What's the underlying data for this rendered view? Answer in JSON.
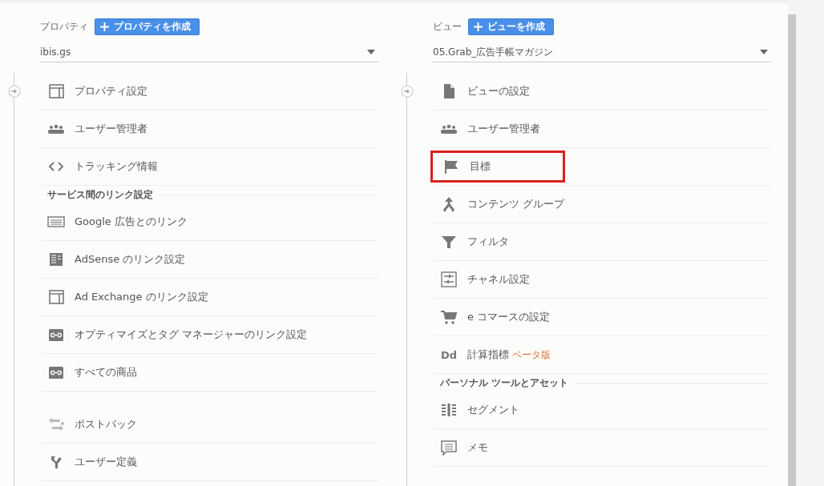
{
  "columns": [
    {
      "label": "プロパティ",
      "create_button": "プロパティを作成",
      "selector": {
        "value": "ibis.gs"
      },
      "groups": [
        {
          "items": [
            {
              "kind": "layout",
              "label": "プロパティ設定",
              "highlighted": false
            },
            {
              "kind": "people",
              "label": "ユーザー管理者",
              "highlighted": false
            },
            {
              "kind": "code",
              "label": "トラッキング情報",
              "highlighted": false
            }
          ]
        },
        {
          "header": "サービス間のリンク設定",
          "items": [
            {
              "kind": "ads",
              "label": "Google 広告とのリンク",
              "highlighted": false
            },
            {
              "kind": "adsense",
              "label": "AdSense のリンク設定",
              "highlighted": false
            },
            {
              "kind": "layout",
              "label": "Ad Exchange のリンク設定",
              "highlighted": false
            },
            {
              "kind": "link",
              "label": "オプティマイズとタグ マネージャーのリンク設定",
              "highlighted": false
            },
            {
              "kind": "link",
              "label": "すべての商品",
              "highlighted": false
            }
          ]
        },
        {
          "items": [
            {
              "kind": "postback",
              "label": "ポストバック",
              "highlighted": false
            },
            {
              "kind": "fork",
              "label": "ユーザー定義",
              "highlighted": false
            }
          ]
        }
      ]
    },
    {
      "label": "ビュー",
      "create_button": "ビューを作成",
      "selector": {
        "value": "05.Grab_広告手帳マガジン"
      },
      "groups": [
        {
          "items": [
            {
              "kind": "doc",
              "label": "ビューの設定",
              "highlighted": false
            },
            {
              "kind": "people",
              "label": "ユーザー管理者",
              "highlighted": false
            },
            {
              "kind": "flag",
              "label": "目標",
              "highlighted": true
            },
            {
              "kind": "merge",
              "label": "コンテンツ グループ",
              "highlighted": false
            },
            {
              "kind": "filter",
              "label": "フィルタ",
              "highlighted": false
            },
            {
              "kind": "channel",
              "label": "チャネル設定",
              "highlighted": false
            },
            {
              "kind": "cart",
              "label": "e コマースの設定",
              "highlighted": false
            },
            {
              "kind": "text",
              "icon_text": "Dd",
              "label": "計算指標",
              "badge": "ベータ版",
              "highlighted": false
            }
          ]
        },
        {
          "header": "パーソナル ツールとアセット",
          "items": [
            {
              "kind": "segment",
              "label": "セグメント",
              "highlighted": false
            },
            {
              "kind": "memo",
              "label": "メモ",
              "highlighted": false
            }
          ]
        }
      ]
    }
  ]
}
